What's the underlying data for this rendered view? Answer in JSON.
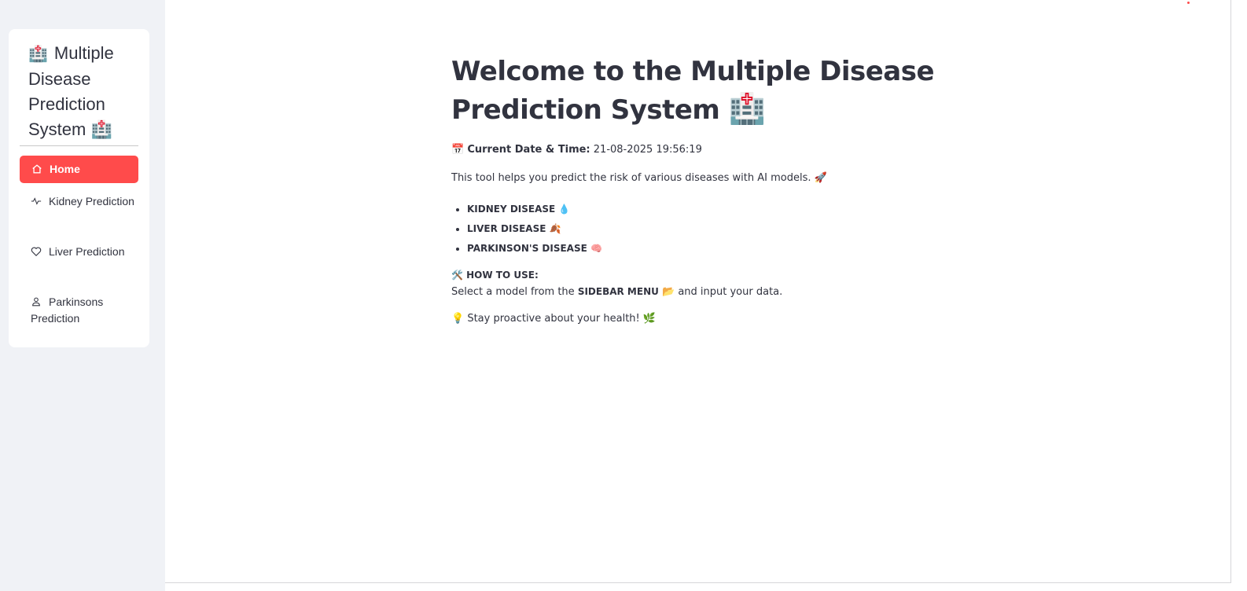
{
  "sidebar": {
    "title_icon": "🏥",
    "title": "Multiple Disease Prediction System",
    "title_emoji": "🏥",
    "items": [
      {
        "label": "Home",
        "icon": "house-icon",
        "active": true
      },
      {
        "label": "Kidney Prediction",
        "icon": "activity-icon",
        "active": false
      },
      {
        "label": "Liver Prediction",
        "icon": "heart-icon",
        "active": false
      },
      {
        "label": "Parkinsons Prediction",
        "icon": "person-icon",
        "active": false
      }
    ]
  },
  "main": {
    "title": "Welcome to the Multiple Disease Prediction System",
    "title_emoji": "🏥",
    "datetime": {
      "icon": "📅",
      "label": "Current Date & Time:",
      "value": "21-08-2025 19:56:19"
    },
    "intro": "This tool helps you predict the risk of various diseases with AI models.",
    "intro_emoji": "🚀",
    "diseases": [
      {
        "label": "KIDNEY DISEASE",
        "emoji": "💧"
      },
      {
        "label": "LIVER DISEASE",
        "emoji": "🍂"
      },
      {
        "label": "PARKINSON'S DISEASE",
        "emoji": "🧠"
      }
    ],
    "howto": {
      "icon": "🛠️",
      "heading": "HOW TO USE:",
      "text_before": "Select a model from the",
      "bold": "SIDEBAR MENU",
      "emoji": "📂",
      "text_after": "and input your data."
    },
    "tip": {
      "icon": "💡",
      "text": "Stay proactive about your health!",
      "emoji": "🌿"
    }
  },
  "colors": {
    "accent": "#ff4b4b",
    "sidebar_bg": "#f0f2f6",
    "text": "#31333f"
  }
}
